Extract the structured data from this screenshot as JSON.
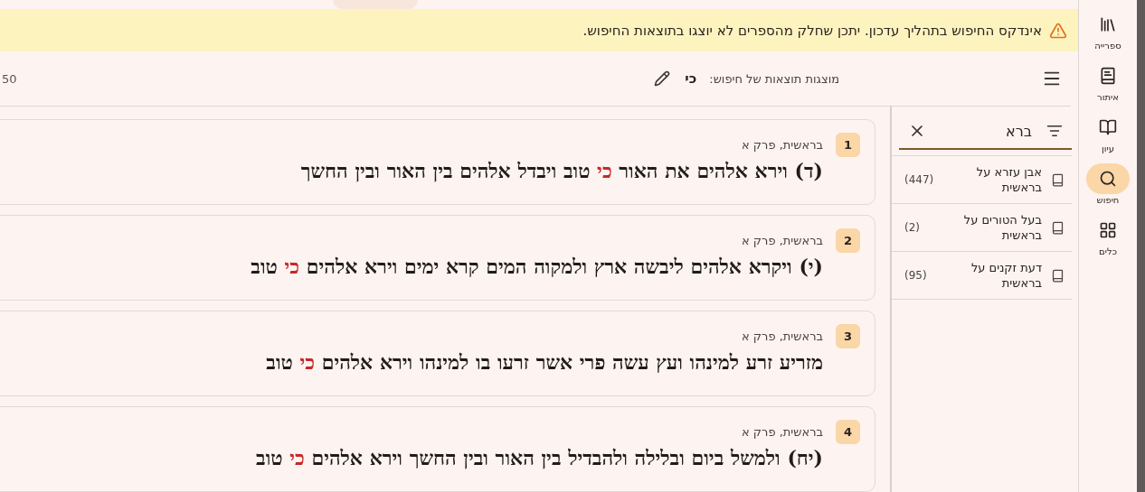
{
  "banner": {
    "text": "אינדקס החיפוש בתהליך עדכון. יתכן שחלק מהספרים לא יוצגו בתוצאות החיפוש."
  },
  "toolbar": {
    "count": "50",
    "label": "מוצגות תוצאות של חיפוש:",
    "query": "כי"
  },
  "results": [
    {
      "number": "1",
      "source": "בראשית, פרק א",
      "segments": [
        {
          "text": "(ד) וירא אלהים את האור ",
          "highlight": false
        },
        {
          "text": "כי",
          "highlight": true
        },
        {
          "text": " טוב ויבדל אלהים בין האור ובין החשך",
          "highlight": false
        }
      ]
    },
    {
      "number": "2",
      "source": "בראשית, פרק א",
      "segments": [
        {
          "text": "(י) ויקרא אלהים ליבשה ארץ ולמקוה המים קרא ימים וירא אלהים ",
          "highlight": false
        },
        {
          "text": "כי",
          "highlight": true
        },
        {
          "text": " טוב",
          "highlight": false
        }
      ]
    },
    {
      "number": "3",
      "source": "בראשית, פרק א",
      "segments": [
        {
          "text": "מזריע זרע למינהו ועץ עשה פרי אשר זרעו בו למינהו וירא אלהים ",
          "highlight": false
        },
        {
          "text": "כי",
          "highlight": true
        },
        {
          "text": " טוב",
          "highlight": false
        }
      ]
    },
    {
      "number": "4",
      "source": "בראשית, פרק א",
      "segments": [
        {
          "text": "(יח) ולמשל ביום ובלילה ולהבדיל בין האור ובין החשך וירא אלהים ",
          "highlight": false
        },
        {
          "text": "כי",
          "highlight": true
        },
        {
          "text": " טוב",
          "highlight": false
        }
      ]
    }
  ],
  "book_search": {
    "value": "ברא",
    "items": [
      {
        "name": "אבן עזרא על בראשית",
        "count": "(447)"
      },
      {
        "name": "בעל הטורים על בראשית",
        "count": "(2)"
      },
      {
        "name": "דעת זקנים על בראשית",
        "count": "(95)"
      }
    ]
  },
  "rail": [
    {
      "kind": "library",
      "label": "ספרייה",
      "selected": false
    },
    {
      "kind": "find",
      "label": "איתור",
      "selected": false
    },
    {
      "kind": "read",
      "label": "עיון",
      "selected": false
    },
    {
      "kind": "search",
      "label": "חיפוש",
      "selected": true
    },
    {
      "kind": "tools",
      "label": "כלים",
      "selected": false
    }
  ]
}
